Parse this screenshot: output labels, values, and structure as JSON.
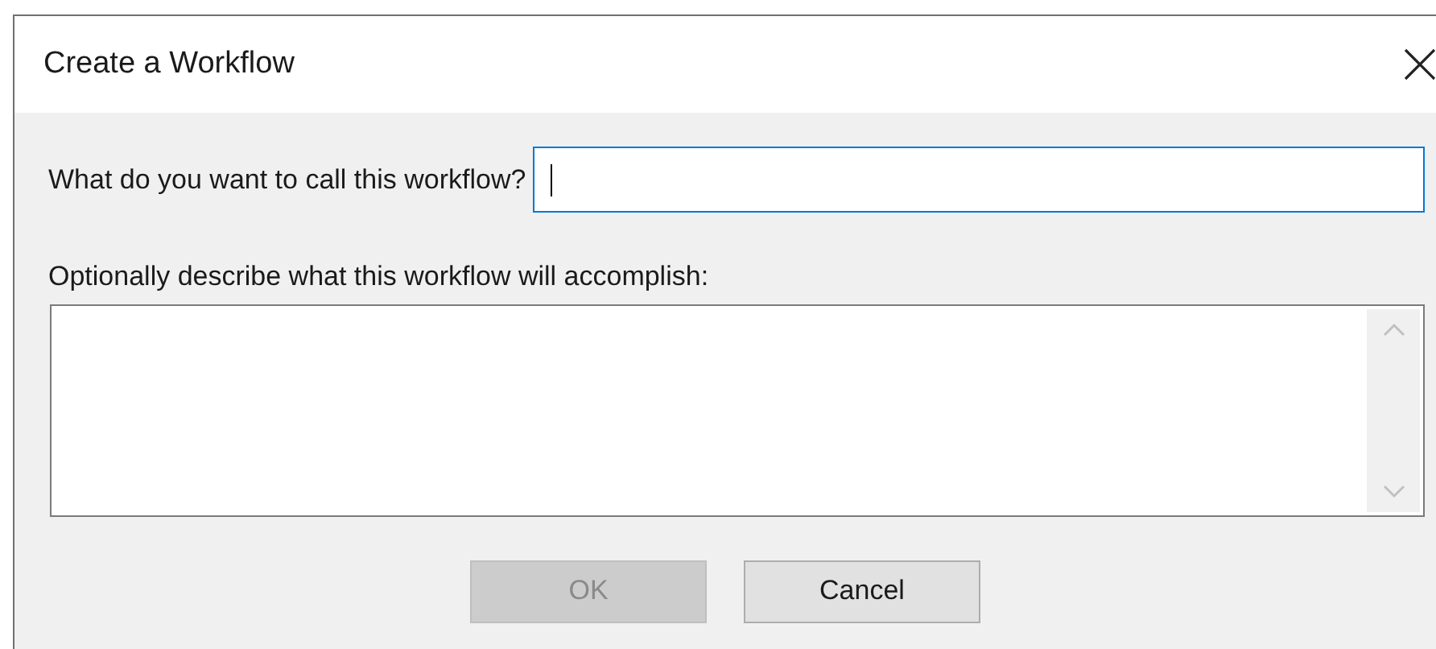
{
  "window": {
    "title": "Create a Workflow"
  },
  "name_field": {
    "label": "What do you want to call this workflow?",
    "focused": true
  },
  "description_field": {
    "label": "Optionally describe what this workflow will accomplish:"
  },
  "buttons": [
    {
      "label": "OK",
      "disabled": true
    },
    {
      "label": "Cancel",
      "disabled": false
    }
  ]
}
